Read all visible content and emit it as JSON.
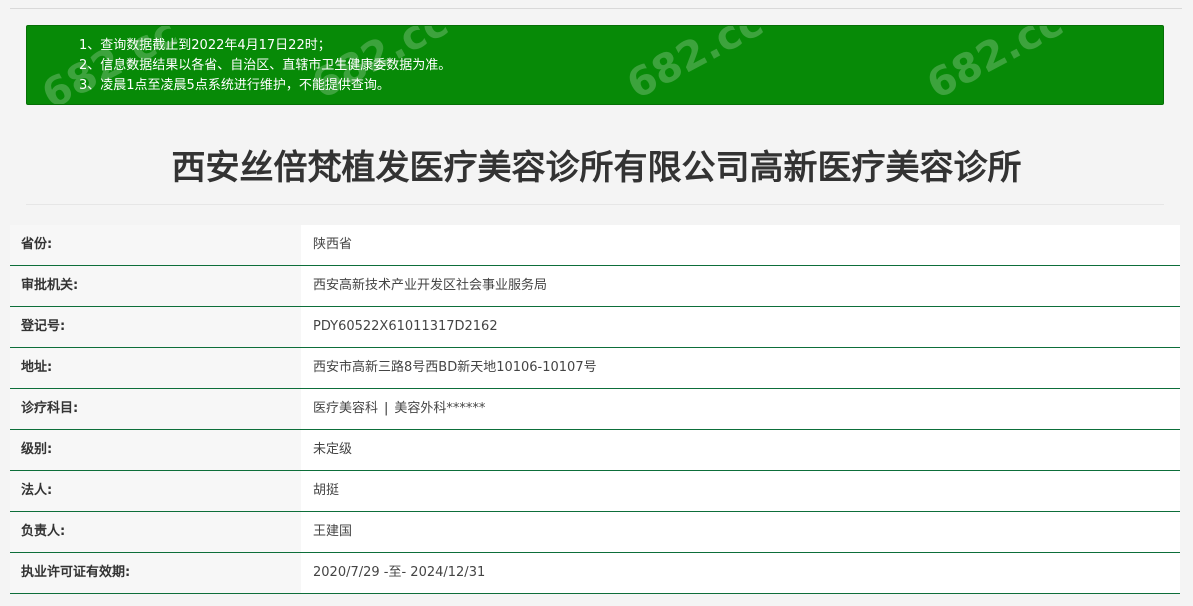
{
  "notice": {
    "lines": [
      "1、查询数据截止到2022年4月17日22时；",
      "2、信息数据结果以各省、自治区、直辖市卫生健康委数据为准。",
      "3、凌晨1点至凌晨5点系统进行维护，不能提供查询。"
    ],
    "background_color": "#078a07",
    "watermark_text": "682.cc"
  },
  "title": "西安丝倍梵植发医疗美容诊所有限公司高新医疗美容诊所",
  "rows": [
    {
      "label": "省份:",
      "value": "陕西省"
    },
    {
      "label": "审批机关:",
      "value": "西安高新技术产业开发区社会事业服务局"
    },
    {
      "label": "登记号:",
      "value": "PDY60522X61011317D2162"
    },
    {
      "label": "地址:",
      "value": "西安市高新三路8号西BD新天地10106-10107号"
    },
    {
      "label": "诊疗科目:",
      "value_part1": "医疗美容科",
      "separator": "|",
      "value_part2": "美容外科******"
    },
    {
      "label": "级别:",
      "value": "未定级"
    },
    {
      "label": "法人:",
      "value": "胡挺"
    },
    {
      "label": "负责人:",
      "value": "王建国"
    },
    {
      "label": "执业许可证有效期:",
      "value": "2020/7/29 -至- 2024/12/31"
    }
  ],
  "row_border_color": "#0d6e3a"
}
